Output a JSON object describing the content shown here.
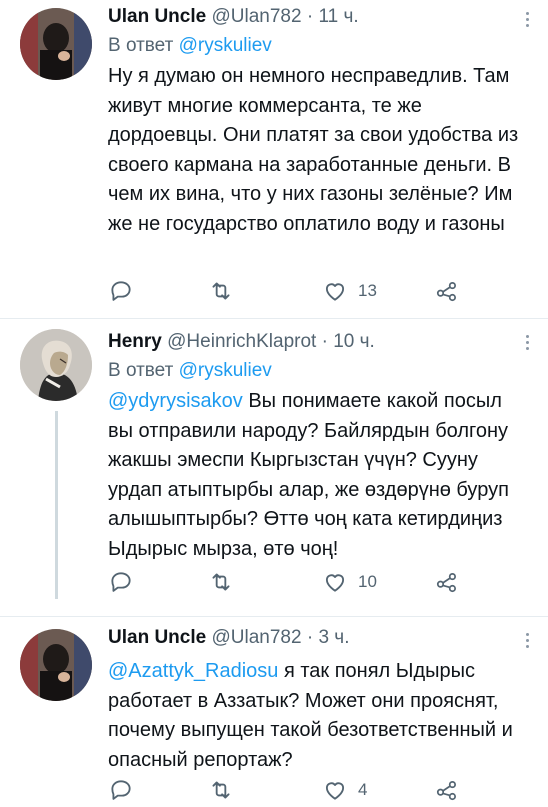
{
  "tweets": [
    {
      "name": "Ulan Uncle",
      "handle": "@Ulan782",
      "dot": "·",
      "time": "11 ч.",
      "reply_prefix": "В ответ",
      "reply_handle": "@ryskuliev",
      "mention": "",
      "text": "Ну я думаю он немного несправедлив. Там живут многие коммерсанта, те же дордоевцы. Они платят за свои удобства из своего кармана на заработанные деньги. В чем их вина, что у них газоны зелёные? Им же не государство оплатило воду и газоны",
      "likes": "13"
    },
    {
      "name": "Henry",
      "handle": "@HeinrichKlaprot",
      "dot": "·",
      "time": "10 ч.",
      "reply_prefix": "В ответ",
      "reply_handle": "@ryskuliev",
      "mention": "@ydyrysisakov",
      "text": "Вы понимаете какой посыл вы отправили народу? Байлярдын болгону жакшы эмеспи Кыргызстан үчүн? Сууну урдап атыптырбы алар, же өздөрүнө буруп алышыптырбы? Өттө чоң ката кетирдиңиз Ыдырыс мырза, өтө чоң!",
      "likes": "10"
    },
    {
      "name": "Ulan Uncle",
      "handle": "@Ulan782",
      "dot": "·",
      "time": "3 ч.",
      "reply_prefix": "",
      "reply_handle": "",
      "mention": "@Azattyk_Radiosu",
      "text": "я так понял Ыдырыс работает в Аззатык? Может они прояснят, почему выпущен такой безответственный и опасный репортаж?",
      "likes": "4"
    }
  ],
  "colors": {
    "link": "#1d9bf0",
    "muted": "#536471",
    "divider": "#e6ecf0"
  },
  "icons": [
    "reply-icon",
    "retweet-icon",
    "like-icon",
    "share-icon",
    "more-icon"
  ]
}
